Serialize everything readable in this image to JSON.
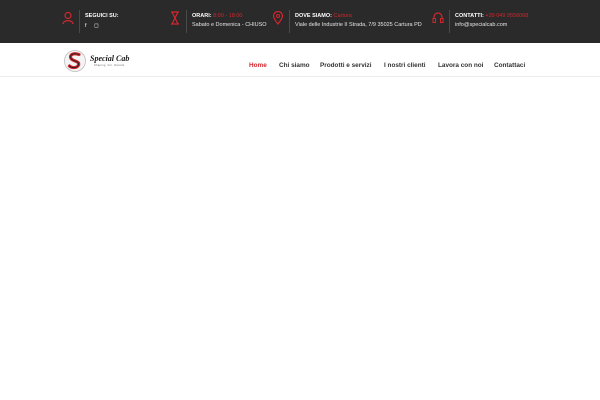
{
  "colors": {
    "accent": "#d2262e",
    "topbar_bg": "#2a2a2a",
    "text_light": "#e6e6e6"
  },
  "topbar": {
    "social": {
      "label": "SEGUICI SU:",
      "icons": [
        "facebook-icon",
        "instagram-icon"
      ],
      "glyphs": {
        "facebook": "f",
        "instagram": "◻"
      }
    },
    "hours": {
      "label": "ORARI:",
      "value": "8:00 - 18:00",
      "line2": "Sabato e Domenica - CHIUSO"
    },
    "address": {
      "label": "DOVE SIAMO:",
      "value": "Cartura",
      "line2": "Viale delle Industrie II Strada, 7/9 35025 Cartura PD"
    },
    "contacts": {
      "label": "CONTATTI:",
      "value": "+39 049 9556068",
      "line2": "info@specialcab.com"
    }
  },
  "logo": {
    "name": "Special Cab",
    "tagline": "Shaping. For. Details"
  },
  "nav": {
    "items": [
      {
        "label": "Home",
        "active": true
      },
      {
        "label": "Chi siamo",
        "active": false
      },
      {
        "label": "Prodotti e servizi",
        "active": false
      },
      {
        "label": "I nostri clienti",
        "active": false
      },
      {
        "label": "Lavora con noi",
        "active": false
      },
      {
        "label": "Contattaci",
        "active": false
      }
    ]
  }
}
